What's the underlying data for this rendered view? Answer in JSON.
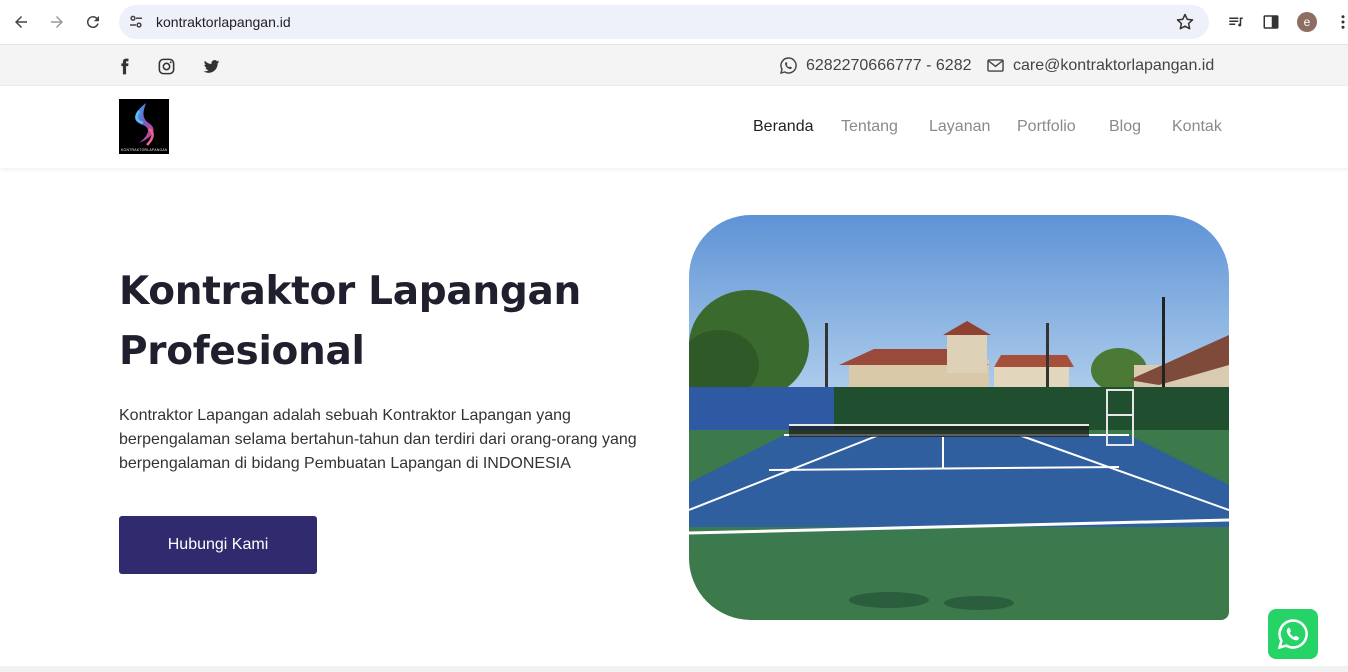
{
  "browser": {
    "url": "kontraktorlapangan.id",
    "profile_initial": "e"
  },
  "topbar": {
    "phone": "6282270666777 - 6282",
    "email": "care@kontraktorlapangan.id"
  },
  "nav": {
    "items": [
      {
        "label": "Beranda",
        "active": true
      },
      {
        "label": "Tentang",
        "active": false
      },
      {
        "label": "Layanan",
        "active": false
      },
      {
        "label": "Portfolio",
        "active": false
      },
      {
        "label": "Blog",
        "active": false
      },
      {
        "label": "Kontak",
        "active": false
      }
    ]
  },
  "logo": {
    "caption": "KONTRAKTORLAPANGAN.ID"
  },
  "hero": {
    "title_line1": "Kontraktor Lapangan",
    "title_line2": "Profesional",
    "description": "Kontraktor Lapangan adalah sebuah Kontraktor Lapangan yang berpengalaman selama bertahun-tahun dan terdiri dari orang-orang yang berpengalaman di bidang Pembuatan Lapangan di INDONESIA",
    "button_label": "Hubungi Kami"
  },
  "icons": {
    "back": "arrow-left-icon",
    "forward": "arrow-right-icon",
    "reload": "reload-icon",
    "site_settings": "tune-icon",
    "bookmark": "star-icon",
    "reading_list": "playlist-icon",
    "side_panel": "side-panel-icon",
    "menu": "kebab-menu-icon",
    "facebook": "facebook-icon",
    "instagram": "instagram-icon",
    "twitter": "twitter-icon",
    "whatsapp": "whatsapp-icon",
    "email": "envelope-icon"
  },
  "colors": {
    "primary_button": "#2f2b6e",
    "whatsapp": "#25d366",
    "title": "#1f1f2e"
  }
}
